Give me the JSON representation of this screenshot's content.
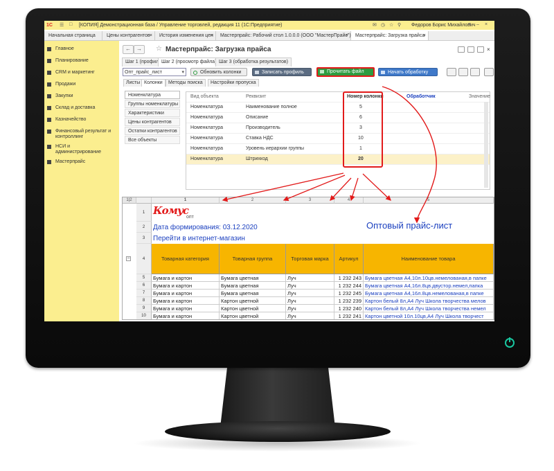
{
  "window": {
    "title": "[КОПИЯ] Демонстрационная база / Управление торговлей, редакция 11  (1С:Предприятие)",
    "logo": "1С",
    "user": "Федоров Борис Михайлович"
  },
  "open_tabs": [
    {
      "label": "Начальная страница"
    },
    {
      "label": "Цены контрагентов"
    },
    {
      "label": "История изменения цен"
    },
    {
      "label": "Мастерпрайс: Рабочий стол 1.0.0.0 (ООО \"МастерПрайс\")"
    },
    {
      "label": "Мастерпрайс: Загрузка прайса"
    }
  ],
  "sidebar": {
    "items": [
      {
        "label": "Главное"
      },
      {
        "label": "Планирование"
      },
      {
        "label": "CRM и маркетинг"
      },
      {
        "label": "Продажи"
      },
      {
        "label": "Закупки"
      },
      {
        "label": "Склад и доставка"
      },
      {
        "label": "Казначейство"
      },
      {
        "label": "Финансовый результат и контроллинг"
      },
      {
        "label": "НСИ и администрирование"
      },
      {
        "label": "Мастерпрайс"
      }
    ]
  },
  "form": {
    "title": "Мастерпрайс: Загрузка прайса",
    "steps": [
      "Шаг 1 (профиль)",
      "Шаг 2 (просмотр файла)",
      "Шаг 3 (обработка результатов)"
    ],
    "sheet_select": "Опт_прайс_лист",
    "buttons": {
      "refresh": "Обновить колонки",
      "save_profile": "Записать профиль",
      "read_file": "Прочитать файл",
      "start": "Начать обработку"
    },
    "subtabs": [
      "Листы",
      "Колонки",
      "Методы поиска",
      "Настройки пропуска"
    ],
    "left_list": [
      "Номенклатура",
      "Группы номенклатуры",
      "Характеристики",
      "Цены контрагентов",
      "Остатки контрагентов",
      "Все объекты"
    ],
    "grid": {
      "columns": [
        "Вид объекта",
        "Реквизит",
        "Номер колонки",
        "Обработчик",
        "Значение"
      ],
      "rows": [
        {
          "object": "Номенклатура",
          "attr": "Наименование полное",
          "col": "5"
        },
        {
          "object": "Номенклатура",
          "attr": "Описание",
          "col": "6"
        },
        {
          "object": "Номенклатура",
          "attr": "Производитель",
          "col": "3"
        },
        {
          "object": "Номенклатура",
          "attr": "Ставка НДС",
          "col": "10"
        },
        {
          "object": "Номенклатура",
          "attr": "Уровень иерархии группы",
          "col": "1"
        },
        {
          "object": "Номенклатура",
          "attr": "Штрихкод",
          "col": "20"
        }
      ]
    }
  },
  "spreadsheet": {
    "outline_levels": [
      "1",
      "2"
    ],
    "col_headers": [
      "1",
      "2",
      "3",
      "4",
      "5"
    ],
    "logo_text": "Комус",
    "logo_sub": "опт",
    "date_line": "Дата формирования: 03.12.2020",
    "title": "Оптовый прайс-лист",
    "shop_link": "Перейти в интернет-магазин",
    "header_row": [
      "Товарная категория",
      "Товарная группа",
      "Торговая марка",
      "Артикул",
      "Наименование товара"
    ],
    "row_numbers": [
      "1",
      "2",
      "3",
      "4",
      "5",
      "6",
      "7",
      "8",
      "9",
      "10",
      "11"
    ],
    "rows": [
      {
        "n": "5",
        "cat": "Бумага и картон",
        "grp": "Бумага цветная",
        "brand": "Луч",
        "art": "1 232 243",
        "name": "Бумага цветная А4,10л.10цв.немелованая,в папке"
      },
      {
        "n": "6",
        "cat": "Бумага и картон",
        "grp": "Бумага цветная",
        "brand": "Луч",
        "art": "1 232 244",
        "name": "Бумага цветная А4,16л.8цв.двустор.немел,папка"
      },
      {
        "n": "7",
        "cat": "Бумага и картон",
        "grp": "Бумага цветная",
        "brand": "Луч",
        "art": "1 232 245",
        "name": "Бумага цветная А4,16л.8цв.немелованая,в папке"
      },
      {
        "n": "8",
        "cat": "Бумага и картон",
        "grp": "Картон цветной",
        "brand": "Луч",
        "art": "1 232 239",
        "name": "Картон белый 8л,А4 Луч Школа творчества мелов"
      },
      {
        "n": "9",
        "cat": "Бумага и картон",
        "grp": "Картон цветной",
        "brand": "Луч",
        "art": "1 232 240",
        "name": "Картон белый 8л,А4 Луч Школа творчества немел"
      },
      {
        "n": "10",
        "cat": "Бумага и картон",
        "grp": "Картон цветной",
        "brand": "Луч",
        "art": "1 232 241",
        "name": "Картон цветной 10л.10цв,А4 Луч Школа творчест"
      },
      {
        "n": "11",
        "cat": "Бумага и картон",
        "grp": "Картон цветной",
        "brand": "Луч",
        "art": "1 232 242",
        "name": "Картон цветной 16л.8цв,А4 Луч Школа творчест"
      }
    ]
  },
  "colors": {
    "accent_yellow": "#fbee8f",
    "highlight_red": "#e21a1a",
    "header_orange": "#f7b500",
    "link_blue": "#1a3fbf",
    "power_led": "#19c7a0"
  }
}
